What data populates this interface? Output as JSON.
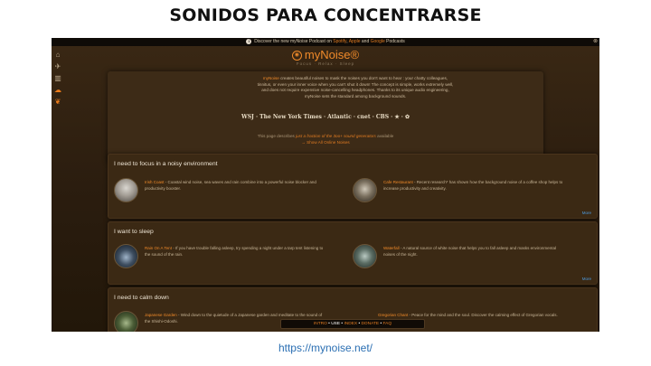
{
  "slide": {
    "title": "SONIDOS PARA CONCENTRARSE",
    "url": "https://mynoise.net/"
  },
  "topbar": {
    "info_icon": "i",
    "text_before": "Discover the new myNoise Podcast on ",
    "spotify": "Spotify",
    "comma": ", ",
    "apple": "Apple",
    "and": " and ",
    "google": "Google",
    "podcasts": " Podcasts",
    "close": "⊗"
  },
  "sidebar": {
    "icons": [
      "home-icon",
      "twitter-icon",
      "books-icon",
      "cloud-icon",
      "leaf-icon"
    ]
  },
  "brand": {
    "name": "myNoise",
    "reg": "®",
    "tagline": "Focus · Relax · Sleep"
  },
  "intro": {
    "brand": "myNoise",
    "line1": " creates beautiful noises to mask the noises you don't want to hear : your chatty colleagues, tinnitus, or even your inner voice when you can't shut it down! The concept is simple, works extremely well, and does not require expensive noise-cancelling headphones. Thanks to its unique audio engineering, myNoise sets the standard among background sounds.",
    "press": "WSJ · The New York Times · Atlantic · cnet · CBS · ★ · ✿"
  },
  "note": {
    "before": "This page describes ",
    "highlight": "just a fraction of the 3oo+ sound generators",
    "after": " available",
    "link": "→ Show All Online Noises"
  },
  "sections": [
    {
      "heading": "I need to focus in a noisy environment",
      "items": [
        {
          "name": "Irish Coast",
          "text": " - Coastal wind noise, sea waves and rain combine into a powerful noise blocker and productivity booster."
        },
        {
          "name": "Cafe Restaurant",
          "text": " - Recent research* has shown how the background noise of a coffee shop helps to increase productivity and creativity."
        }
      ],
      "more": "More"
    },
    {
      "heading": "I want to sleep",
      "items": [
        {
          "name": "Rain On A Tent",
          "text": " - If you have trouble falling asleep, try spending a night under a tarp tent listening to the sound of the rain."
        },
        {
          "name": "Waterfall",
          "text": " - A natural source of white noise that helps you to fall asleep and masks environmental noises of the night."
        }
      ],
      "more": "More"
    },
    {
      "heading": "I need to calm down",
      "items": [
        {
          "name": "Japanese Garden",
          "text": " - Wind down to the quietude of a Japanese garden and meditate to the sound of the Shishi-Odoshi."
        },
        {
          "name": "Gregorian Chant",
          "text": " - Peace for the mind and the soul. Discover the calming effect of Gregorian vocals."
        }
      ],
      "more": ""
    }
  ],
  "bottom_nav": {
    "intro": "INTRO",
    "use": "USE",
    "index": "INDEX",
    "donate": "DONATE",
    "faq": "FAQ",
    "sep": " • "
  }
}
